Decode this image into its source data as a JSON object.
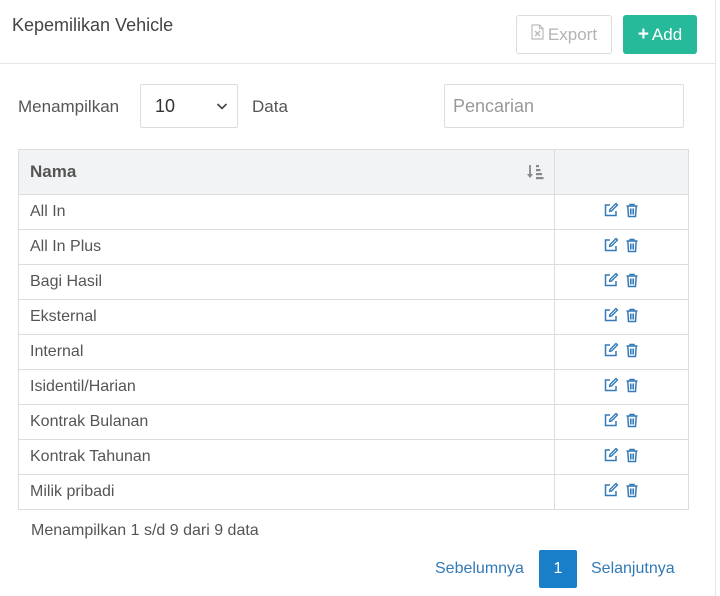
{
  "page": {
    "title": "Kepemilikan Vehicle"
  },
  "toolbar": {
    "export_label": "Export",
    "add_label": "Add"
  },
  "controls": {
    "show_label": "Menampilkan",
    "page_size": "10",
    "data_label": "Data",
    "search_placeholder": "Pencarian",
    "search_value": ""
  },
  "table": {
    "columns": [
      "Nama",
      ""
    ],
    "rows": [
      {
        "nama": "All In"
      },
      {
        "nama": "All In Plus"
      },
      {
        "nama": "Bagi Hasil"
      },
      {
        "nama": "Eksternal"
      },
      {
        "nama": "Internal"
      },
      {
        "nama": "Isidentil/Harian"
      },
      {
        "nama": "Kontrak Bulanan"
      },
      {
        "nama": "Kontrak Tahunan"
      },
      {
        "nama": "Milik pribadi"
      }
    ]
  },
  "footer": {
    "info": "Menampilkan 1 s/d 9 dari 9 data",
    "prev_label": "Sebelumnya",
    "current_page": "1",
    "next_label": "Selanjutnya"
  },
  "icons": {
    "export": "file-excel-icon",
    "add": "plus-icon",
    "sort": "sort-amount-icon",
    "edit": "edit-icon",
    "delete": "trash-icon",
    "select": "chevron-down-icon"
  },
  "colors": {
    "add_button": "#26b99a",
    "link": "#337ab7",
    "active_page": "#1a7fc9",
    "table_header_bg": "#f2f3f5"
  }
}
